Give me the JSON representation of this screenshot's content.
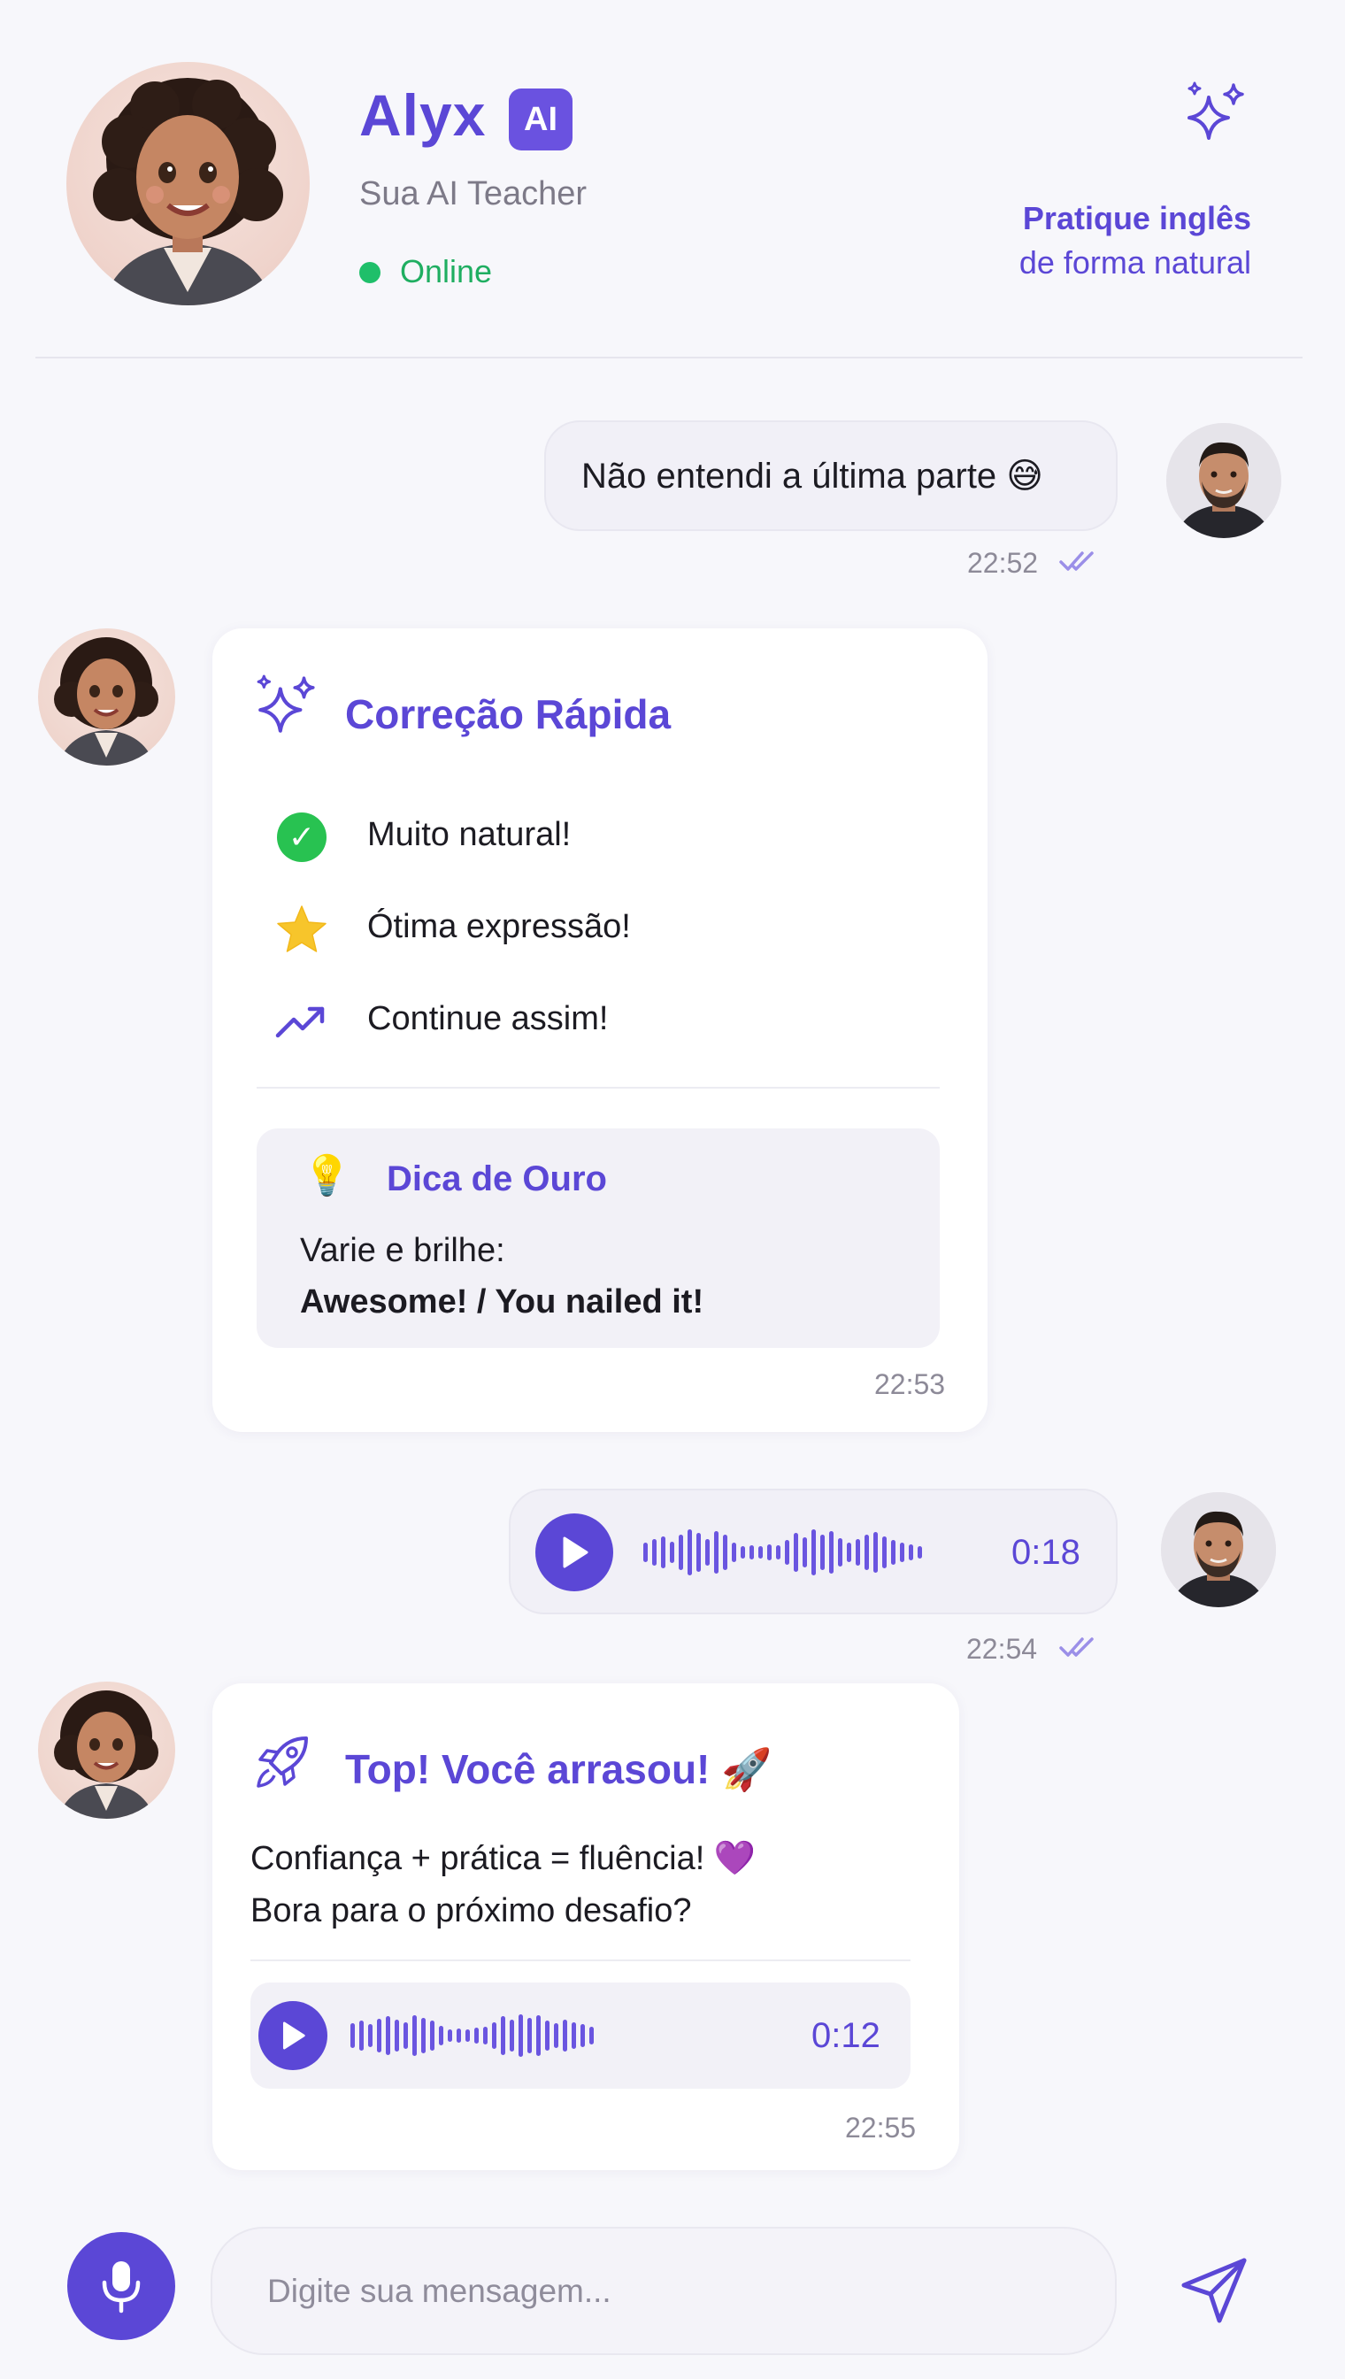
{
  "header": {
    "name": "Alyx",
    "badge": "AI",
    "subtitle": "Sua AI Teacher",
    "status": "Online",
    "tagline_line1": "Pratique inglês",
    "tagline_line2": "de forma natural"
  },
  "messages": {
    "user_text": {
      "text": "Não entendi a última parte 😅",
      "time": "22:52"
    },
    "correction_card": {
      "title": "Correção Rápida",
      "items": [
        "Muito natural!",
        "Ótima expressão!",
        "Continue assim!"
      ],
      "tip_title": "Dica de Ouro",
      "tip_line1": "Varie e brilhe:",
      "tip_line2": "Awesome! / You nailed it!",
      "time": "22:53"
    },
    "user_audio": {
      "duration": "0:18",
      "time": "22:54"
    },
    "bot_card": {
      "title": "Top! Você arrasou! 🚀",
      "line1": "Confiança + prática = fluência! 💜",
      "line2": "Bora para o próximo desafio?",
      "audio_duration": "0:12",
      "time": "22:55"
    }
  },
  "composer": {
    "placeholder": "Digite sua mensagem..."
  },
  "icons": {
    "sparkles": "sparkles-icon",
    "check": "check-circle-icon",
    "star": "star-icon",
    "trend": "trending-up-icon",
    "bulb": "lightbulb-icon",
    "rocket": "rocket-icon",
    "play": "play-icon",
    "mic": "microphone-icon",
    "send": "send-icon",
    "read": "double-check-icon"
  },
  "colors": {
    "accent": "#5b47d6",
    "online": "#1fbf6a",
    "background": "#f7f7fb"
  }
}
